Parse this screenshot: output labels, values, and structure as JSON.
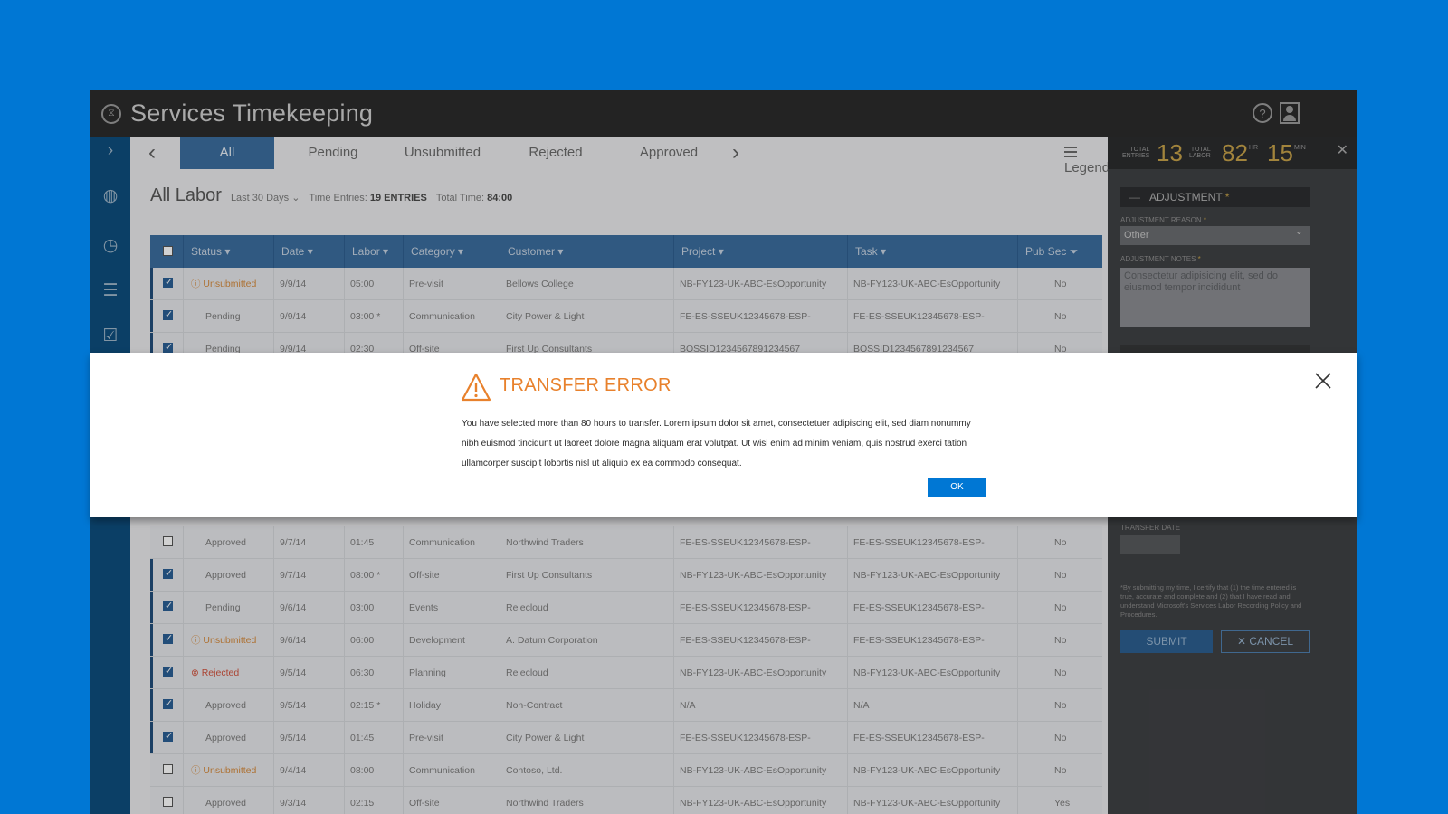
{
  "app": {
    "title": "Services Timekeeping",
    "help_glyph": "?"
  },
  "tabs": {
    "items": [
      "All",
      "Pending",
      "Unsubmitted",
      "Rejected",
      "Approved"
    ],
    "active": "All",
    "legend_label": "Legend"
  },
  "labor": {
    "heading": "All Labor",
    "range": "Last 30 Days",
    "entries_label": "Time Entries:",
    "entries_value": "19 ENTRIES",
    "total_label": "Total Time:",
    "total_value": "84:00"
  },
  "grid": {
    "columns": [
      "Status",
      "Date",
      "Labor",
      "Category",
      "Customer",
      "Project",
      "Task",
      "Pub Sec"
    ],
    "rows_top": [
      {
        "checked": true,
        "status": "Unsubmitted",
        "date": "9/9/14",
        "labor": "05:00",
        "category": "Pre-visit",
        "customer": "Bellows College",
        "project": "NB-FY123-UK-ABC-EsOpportunity",
        "task": "NB-FY123-UK-ABC-EsOpportunity",
        "pubsec": "No"
      },
      {
        "checked": true,
        "status": "Pending",
        "date": "9/9/14",
        "labor": "03:00 *",
        "category": "Communication",
        "customer": "City Power & Light",
        "project": "FE-ES-SSEUK12345678-ESP-",
        "task": "FE-ES-SSEUK12345678-ESP-",
        "pubsec": "No"
      },
      {
        "checked": true,
        "status": "Pending",
        "date": "9/9/14",
        "labor": "02:30",
        "category": "Off-site",
        "customer": "First Up Consultants",
        "project": "BOSSID1234567891234567",
        "task": "BOSSID1234567891234567",
        "pubsec": "No"
      }
    ],
    "rows_bottom": [
      {
        "checked": false,
        "status": "Approved",
        "date": "9/7/14",
        "labor": "01:45",
        "category": "Communication",
        "customer": "Northwind Traders",
        "project": "FE-ES-SSEUK12345678-ESP-",
        "task": "FE-ES-SSEUK12345678-ESP-",
        "pubsec": "No"
      },
      {
        "checked": true,
        "status": "Approved",
        "date": "9/7/14",
        "labor": "08:00 *",
        "category": "Off-site",
        "customer": "First Up Consultants",
        "project": "NB-FY123-UK-ABC-EsOpportunity",
        "task": "NB-FY123-UK-ABC-EsOpportunity",
        "pubsec": "No"
      },
      {
        "checked": true,
        "status": "Pending",
        "date": "9/6/14",
        "labor": "03:00",
        "category": "Events",
        "customer": "Relecloud",
        "project": "FE-ES-SSEUK12345678-ESP-",
        "task": "FE-ES-SSEUK12345678-ESP-",
        "pubsec": "No"
      },
      {
        "checked": true,
        "status": "Unsubmitted",
        "date": "9/6/14",
        "labor": "06:00",
        "category": "Development",
        "customer": "A. Datum Corporation",
        "project": "FE-ES-SSEUK12345678-ESP-",
        "task": "FE-ES-SSEUK12345678-ESP-",
        "pubsec": "No"
      },
      {
        "checked": true,
        "status": "Rejected",
        "date": "9/5/14",
        "labor": "06:30",
        "category": "Planning",
        "customer": "Relecloud",
        "project": "NB-FY123-UK-ABC-EsOpportunity",
        "task": "NB-FY123-UK-ABC-EsOpportunity",
        "pubsec": "No"
      },
      {
        "checked": true,
        "status": "Approved",
        "date": "9/5/14",
        "labor": "02:15 *",
        "category": "Holiday",
        "customer": "Non-Contract",
        "project": "N/A",
        "task": "N/A",
        "pubsec": "No"
      },
      {
        "checked": true,
        "status": "Approved",
        "date": "9/5/14",
        "labor": "01:45",
        "category": "Pre-visit",
        "customer": "City Power & Light",
        "project": "FE-ES-SSEUK12345678-ESP-",
        "task": "FE-ES-SSEUK12345678-ESP-",
        "pubsec": "No"
      },
      {
        "checked": false,
        "status": "Unsubmitted",
        "date": "9/4/14",
        "labor": "08:00",
        "category": "Communication",
        "customer": "Contoso, Ltd.",
        "project": "NB-FY123-UK-ABC-EsOpportunity",
        "task": "NB-FY123-UK-ABC-EsOpportunity",
        "pubsec": "No"
      },
      {
        "checked": false,
        "status": "Approved",
        "date": "9/3/14",
        "labor": "02:15",
        "category": "Off-site",
        "customer": "Northwind Traders",
        "project": "NB-FY123-UK-ABC-EsOpportunity",
        "task": "NB-FY123-UK-ABC-EsOpportunity",
        "pubsec": "Yes"
      }
    ]
  },
  "panel": {
    "entries_label_1": "TOTAL",
    "entries_label_2": "ENTRIES",
    "entries_value": "13",
    "labor_label_1": "TOTAL",
    "labor_label_2": "LABOR",
    "hours_value": "82",
    "hours_unit": "HR",
    "minutes_value": "15",
    "minutes_unit": "MIN",
    "adjustment_title": "ADJUSTMENT",
    "reason_label": "ADJUSTMENT REASON",
    "reason_value": "Other",
    "notes_label": "ADJUSTMENT NOTES",
    "notes_value": "Consectetur adipisicing elit, sed do eiusmod tempor incididunt",
    "transfer_date_label": "TRANSFER DATE",
    "legal_text": "*By submitting my time, I certify that (1) the time entered is true, accurate and complete and (2) that I have read and understand Microsoft's Services Labor Recording Policy and Procedures.",
    "submit_label": "SUBMIT",
    "cancel_label": "CANCEL"
  },
  "modal": {
    "title": "TRANSFER ERROR",
    "message": "You have selected more than 80 hours to transfer. Lorem ipsum dolor sit amet, consectetuer adipiscing elit, sed diam nonummy nibh euismod tincidunt ut laoreet dolore magna aliquam erat volutpat. Ut wisi enim ad minim veniam, quis nostrud exerci tation ullamcorper suscipit lobortis nisl ut aliquip ex ea commodo consequat.",
    "ok_label": "OK"
  },
  "colors": {
    "background": "#0077d4",
    "accent": "#0077d4",
    "warning": "#e8812c",
    "grid_header": "#3b6d9e",
    "unsubmitted": "#d48a3e",
    "rejected": "#d0533f"
  }
}
